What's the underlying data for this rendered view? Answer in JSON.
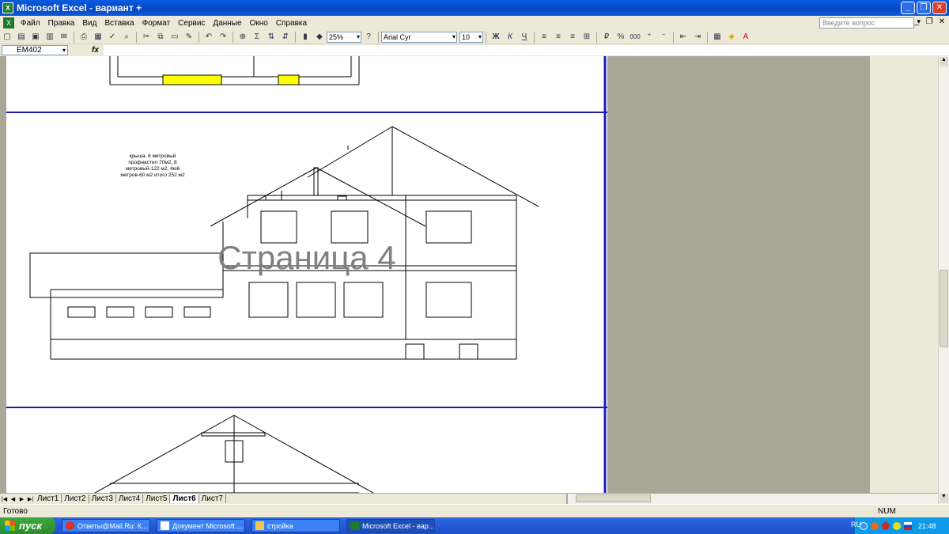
{
  "window": {
    "title": "Microsoft Excel - вариант +"
  },
  "menu": [
    "Файл",
    "Правка",
    "Вид",
    "Вставка",
    "Формат",
    "Сервис",
    "Данные",
    "Окно",
    "Справка"
  ],
  "help_placeholder": "Введите вопрос",
  "toolbar": {
    "zoom": "25%",
    "font": "Arial Cyr",
    "font_size": "10",
    "bold": "Ж",
    "italic": "К",
    "underline": "Ч",
    "percent": "%",
    "thousands": "000"
  },
  "formula": {
    "namebox": "EM402",
    "fx": "fx"
  },
  "sheet": {
    "note_lines": [
      "крыша. 6 метровый",
      "профнастил 70м2, 8",
      "метровый-122 м2, 4ю6",
      "метров-60 м2 итого 252 м2"
    ],
    "watermark": "Страница 4"
  },
  "tabs": [
    "Лист1",
    "Лист2",
    "Лист3",
    "Лист4",
    "Лист5",
    "Лист6",
    "Лист7"
  ],
  "active_tab": "Лист6",
  "status": {
    "ready": "Готово",
    "num": "NUM"
  },
  "taskbar": {
    "start": "пуск",
    "tasks": [
      "Ответы@Mail.Ru: К...",
      "Документ Microsoft ...",
      "стройка",
      "Microsoft Excel - вар..."
    ],
    "lang": "RU",
    "clock": "21:48"
  }
}
